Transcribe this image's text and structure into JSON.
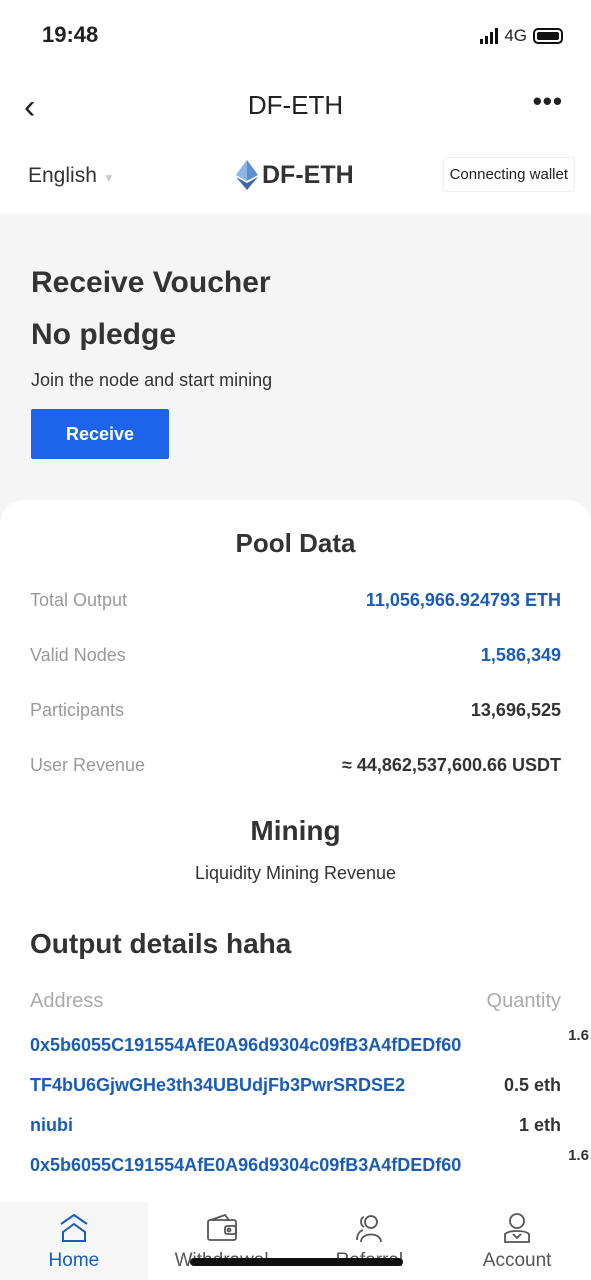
{
  "status": {
    "time": "19:48",
    "network": "4G"
  },
  "nav": {
    "title": "DF-ETH"
  },
  "header": {
    "language": "English",
    "brand": "DF-ETH",
    "wallet_button": "Connecting wallet"
  },
  "hero": {
    "title1": "Receive Voucher",
    "title2": "No pledge",
    "subtitle": "Join the node and start mining",
    "button": "Receive"
  },
  "pool": {
    "title": "Pool Data",
    "rows": [
      {
        "label": "Total Output",
        "value": "11,056,966.924793 ETH",
        "highlight": true
      },
      {
        "label": "Valid Nodes",
        "value": "1,586,349",
        "highlight": true
      },
      {
        "label": "Participants",
        "value": "13,696,525",
        "highlight": false
      },
      {
        "label": "User Revenue",
        "value": "≈ 44,862,537,600.66 USDT",
        "highlight": false
      }
    ]
  },
  "mining": {
    "title": "Mining",
    "subtitle": "Liquidity Mining Revenue"
  },
  "output": {
    "title": "Output details haha",
    "col_address": "Address",
    "col_quantity": "Quantity",
    "rows": [
      {
        "address": "0x5b6055C191554AfE0A96d9304c09fB3A4fDEDf60",
        "quantity": "1.6"
      },
      {
        "address": "TF4bU6GjwGHe3th34UBUdjFb3PwrSRDSE2",
        "quantity": "0.5 eth"
      },
      {
        "address": "niubi",
        "quantity": "1 eth"
      },
      {
        "address": "0x5b6055C191554AfE0A96d9304c09fB3A4fDEDf60",
        "quantity": "1.6"
      }
    ]
  },
  "tabs": [
    {
      "label": "Home",
      "icon": "home-icon"
    },
    {
      "label": "Withdrawal",
      "icon": "wallet-icon"
    },
    {
      "label": "Referral",
      "icon": "users-icon"
    },
    {
      "label": "Account",
      "icon": "user-icon"
    }
  ],
  "colors": {
    "accent": "#1d64ea",
    "link": "#1a5cba"
  }
}
